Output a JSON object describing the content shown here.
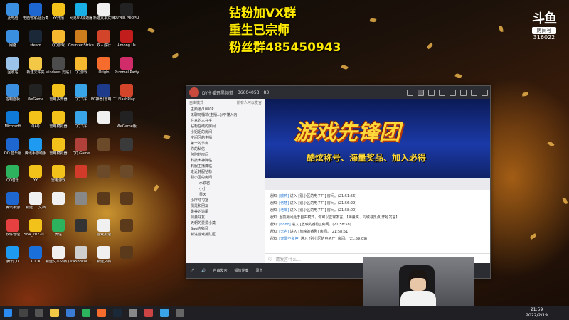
{
  "desktop_icons": [
    {
      "label": "此电脑",
      "color": "#3b8fe0"
    },
    {
      "label": "电脑管家/运行截图编辑",
      "color": "#1e66d0"
    },
    {
      "label": "YY开播",
      "color": "#f2c21b"
    },
    {
      "label": "网易UU加速器",
      "color": "#19b0e8"
    },
    {
      "label": "新建文本文档",
      "color": "#f0f0f0"
    },
    {
      "label": "SUPER PEOPLE CBT",
      "color": "#222222"
    },
    {
      "label": "网络",
      "color": "#3b8fe0"
    },
    {
      "label": "steam",
      "color": "#1b2838"
    },
    {
      "label": "QQ游戏",
      "color": "#f5b82e"
    },
    {
      "label": "Counter-Strike Global Off...",
      "color": "#ce7d1c"
    },
    {
      "label": "双人成行",
      "color": "#d2452a"
    },
    {
      "label": "Among Us",
      "color": "#c21d1d"
    },
    {
      "label": "回收站",
      "color": "#9cc4ea"
    },
    {
      "label": "新建文件夹",
      "color": "#f3c846"
    },
    {
      "label": "windows 剪贴 片着器/器",
      "color": "#4c4c4c"
    },
    {
      "label": "QQ游戏",
      "color": "#f5b82e"
    },
    {
      "label": "Origin",
      "color": "#f56c2d"
    },
    {
      "label": "Pummel Party",
      "color": "#d02c6a"
    },
    {
      "label": "控制面板",
      "color": "#3b8fe0"
    },
    {
      "label": "WeGame",
      "color": "#222222"
    },
    {
      "label": "雷电多开器",
      "color": "#f2c21b"
    },
    {
      "label": "QQ飞车",
      "color": "#3aa4e8"
    },
    {
      "label": "PC神器(雷电)二次编辑",
      "color": "#1e3a8a"
    },
    {
      "label": "FlashPlay",
      "color": "#d2452a"
    },
    {
      "label": "Microsoft",
      "color": "#0f7ad8"
    },
    {
      "label": "QAQ",
      "color": "#f2c21b"
    },
    {
      "label": "雷电模拟器",
      "color": "#f2c21b"
    },
    {
      "label": "QQ飞车",
      "color": "#3aa4e8"
    },
    {
      "label": "",
      "color": "#f0f0f0"
    },
    {
      "label": "WeGame版",
      "color": "#222222"
    },
    {
      "label": "QQ 音乐版",
      "color": "#1e66d0"
    },
    {
      "label": "腾讯手游助手",
      "color": "#1e9af0"
    },
    {
      "label": "雷电模拟器",
      "color": "#f2c21b"
    },
    {
      "label": "QQ Game",
      "color": "#b0413a"
    },
    {
      "label": "",
      "color": "#6b4a2a"
    },
    {
      "label": "",
      "color": "#3a3a3a"
    },
    {
      "label": "QQ音乐",
      "color": "#2db35d"
    },
    {
      "label": "YY",
      "color": "#f2c21b"
    },
    {
      "label": "雷电游戏",
      "color": "#f2c21b"
    },
    {
      "label": "",
      "color": "#d23a2a"
    },
    {
      "label": "",
      "color": "#6b4a2a"
    },
    {
      "label": "",
      "color": "#6b4a2a"
    },
    {
      "label": "腾讯手游",
      "color": "#1e66d0"
    },
    {
      "label": "新建 ... 文档",
      "color": "#f0f0f0"
    },
    {
      "label": "",
      "color": "#f0f0f0"
    },
    {
      "label": "",
      "color": "#888888"
    },
    {
      "label": "",
      "color": "#5a3a1a"
    },
    {
      "label": "",
      "color": "#5a3a1a"
    },
    {
      "label": "软件管理",
      "color": "#e64040"
    },
    {
      "label": "584_20220...",
      "color": "#f2c21b"
    },
    {
      "label": "微信",
      "color": "#2db35d"
    },
    {
      "label": "",
      "color": "#333333"
    },
    {
      "label": "游戏加速",
      "color": "#f0f0f0"
    },
    {
      "label": "",
      "color": "#5a3a1a"
    },
    {
      "label": "腾讯QQ",
      "color": "#1e9af0"
    },
    {
      "label": "KOOK",
      "color": "#1a6fd8"
    },
    {
      "label": "新建文本文档 (2)",
      "color": "#f0f0f0"
    },
    {
      "label": "2A5B8F8C...",
      "color": "#cfcfcf"
    },
    {
      "label": "新建文档",
      "color": "#f0f0f0"
    },
    {
      "label": "",
      "color": "#5a3a1a"
    }
  ],
  "overlay": {
    "line1": "钻粉加VX群",
    "line2": "重生已宗师",
    "line3": "粉丝群485450943"
  },
  "logo": {
    "brand": "斗鱼",
    "room_label": "房间号",
    "room_id": "316022"
  },
  "window": {
    "title": "DY主播开黑频道",
    "channel_id": "36604053",
    "count": "83",
    "sidebar_header": "自由模式",
    "sidebar_link": "所有人可以发言",
    "channels": [
      {
        "name": "主频道/1080P",
        "sub": false
      },
      {
        "name": "无聊马桶坑(主播...)/不懂入内",
        "sub": false
      },
      {
        "name": "在意的人在乎",
        "sub": false
      },
      {
        "name": "钻粉在线的房间",
        "sub": false
      },
      {
        "name": "小姐姐的房间",
        "sub": false
      },
      {
        "name": "空间区的主播",
        "sub": false
      },
      {
        "name": "第一的节奏",
        "sub": false
      },
      {
        "name": "你的私信",
        "sub": false
      },
      {
        "name": "阿阿的房间",
        "sub": false
      },
      {
        "name": "科技大神降临",
        "sub": false
      },
      {
        "name": "韩服主播降临",
        "sub": false
      },
      {
        "name": "走近韩服钻粉",
        "sub": false
      },
      {
        "name": "别小区的房间",
        "sub": false
      },
      {
        "name": "水铁君",
        "sub": true
      },
      {
        "name": "小小",
        "sub": true
      },
      {
        "name": "果天",
        "sub": true
      },
      {
        "name": "小厅动习室",
        "sub": false
      },
      {
        "name": "侧是和朋友",
        "sub": false
      },
      {
        "name": "最美的追尾",
        "sub": false
      },
      {
        "name": "测量好友",
        "sub": false
      },
      {
        "name": "天朝的爱爱小莫",
        "sub": false
      },
      {
        "name": "Sao的房间",
        "sub": false
      },
      {
        "name": "新进游戏排队区",
        "sub": false
      }
    ],
    "banner_title": "游戏先锋团",
    "banner_sub": "酷炫称号、海量奖品、加入必得",
    "messages": [
      {
        "who": "通知:",
        "user": "[欧鸭]",
        "text": "进入 [别小区的电子厂] 房间。(21:51:56)"
      },
      {
        "who": "通知:",
        "user": "[伤悲]",
        "text": "进入 [别小区的电子厂] 房间。(21:56:29)"
      },
      {
        "who": "通知:",
        "user": "[老年]",
        "text": "进入 [别小区的电子厂] 房间。(21:58:00)"
      },
      {
        "who": "通知:",
        "user": "",
        "text": "当前房间处于自由模式，你可以正常发言。【海量奖、同城寻觅点 开始发言】"
      },
      {
        "who": "通知:",
        "user": "[nono]",
        "text": "进入 [放映的番剧] 房间。(21:58:58)"
      },
      {
        "who": "通知:",
        "user": "[无名]",
        "text": "进入 [放映的番剧] 房间。(21:58:51)"
      },
      {
        "who": "通知:",
        "user": "[宠爱不会停]",
        "text": "进入 [别小区的电子厂] 房间。(21:59:09)"
      }
    ],
    "input_placeholder": "请发言什么...",
    "bottom": {
      "mode": "自由发言",
      "music": "播放伴奏",
      "record": "录音"
    }
  },
  "taskbar": {
    "time": "21:59",
    "date": "2022/2/19"
  }
}
